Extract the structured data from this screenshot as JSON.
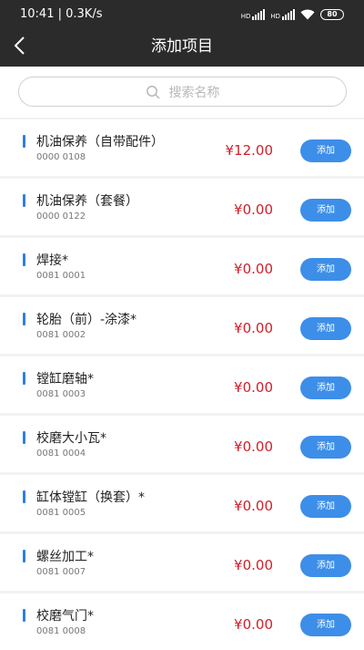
{
  "status_bar": {
    "time": "10:41",
    "speed": "0.3K/s",
    "signal1_label": "HD",
    "signal2_label": "HD",
    "battery": "80"
  },
  "header": {
    "title": "添加项目"
  },
  "search": {
    "placeholder": "搜索名称"
  },
  "items": [
    {
      "name": "机油保养（自带配件）",
      "code": "0000 0108",
      "price": "¥12.00",
      "button": "添加"
    },
    {
      "name": "机油保养（套餐）",
      "code": "0000 0122",
      "price": "¥0.00",
      "button": "添加"
    },
    {
      "name": "焊接*",
      "code": "0081 0001",
      "price": "¥0.00",
      "button": "添加"
    },
    {
      "name": "轮胎（前）-涂漆*",
      "code": "0081 0002",
      "price": "¥0.00",
      "button": "添加"
    },
    {
      "name": "镗缸磨轴*",
      "code": "0081 0003",
      "price": "¥0.00",
      "button": "添加"
    },
    {
      "name": "校磨大小瓦*",
      "code": "0081 0004",
      "price": "¥0.00",
      "button": "添加"
    },
    {
      "name": "缸体镗缸（换套）*",
      "code": "0081 0005",
      "price": "¥0.00",
      "button": "添加"
    },
    {
      "name": "螺丝加工*",
      "code": "0081 0007",
      "price": "¥0.00",
      "button": "添加"
    },
    {
      "name": "校磨气门*",
      "code": "0081 0008",
      "price": "¥0.00",
      "button": "添加"
    }
  ],
  "colors": {
    "accent": "#3d8ee8",
    "price": "#d0202a",
    "header_bg": "#2b2b2b"
  }
}
